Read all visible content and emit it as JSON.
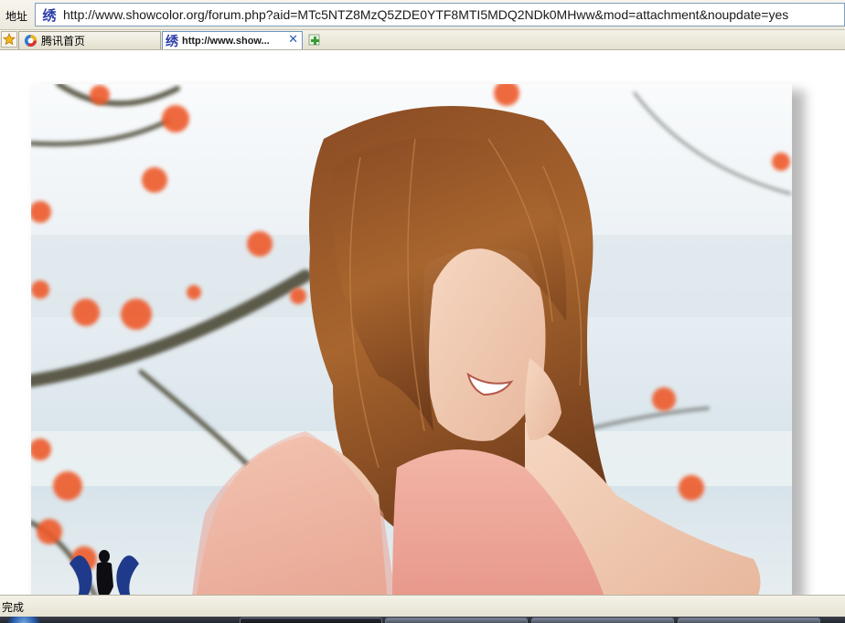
{
  "address_bar": {
    "label": "地址",
    "site_icon_glyph": "绣",
    "url": "http://www.showcolor.org/forum.php?aid=MTc5NTZ8MzQ5ZDE0YTF8MTI5MDQ2NDk0MHww&mod=attachment&noupdate=yes"
  },
  "tabs": {
    "favorites_icon": "star-icon",
    "items": [
      {
        "label": "腾讯首页",
        "icon": "qq-browser-icon",
        "active": false
      },
      {
        "label": "http://www.show...",
        "icon_glyph": "绣",
        "active": true,
        "close_icon": "close-icon"
      }
    ],
    "new_tab_icon": "new-tab-icon"
  },
  "content": {
    "image": "photo of a smiling woman with long auburn hair in a pink knit top, red blossoms on branches, hazy blue sky background",
    "watermark_icon": "silhouette-logo-icon"
  },
  "status_bar": {
    "text": "完成"
  },
  "colors": {
    "chrome_bg": "#ece9dd",
    "tab_active_border": "#6f93c3",
    "url_border": "#7f9db9",
    "site_icon": "#2d3ea8",
    "blossom": "#ee5a2c"
  }
}
